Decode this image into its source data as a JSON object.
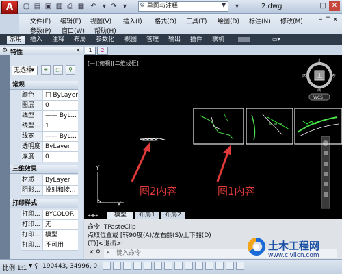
{
  "title_bar": {
    "app_logo": "A",
    "workspace": "草图与注释",
    "document_title": "2.dwg"
  },
  "menu": {
    "row1": [
      "文件(F)",
      "编辑(E)",
      "视图(V)",
      "插入(I)",
      "格式(O)",
      "工具(T)",
      "绘图(D)",
      "标注(N)",
      "修改(M)"
    ],
    "row2": [
      "参数(P)",
      "窗口(W)",
      "帮助(H)"
    ]
  },
  "ribbon_tabs": [
    "常用",
    "插入",
    "注释",
    "布局",
    "参数化",
    "视图",
    "管理",
    "输出",
    "插件",
    "联机"
  ],
  "properties_panel": {
    "title": "特性",
    "selection": "无选择",
    "sections": [
      {
        "name": "常规",
        "rows": [
          {
            "label": "颜色",
            "value": "□ ByLayer"
          },
          {
            "label": "图层",
            "value": "0"
          },
          {
            "label": "线型",
            "value": "—— ByL..."
          },
          {
            "label": "线型...",
            "value": "1"
          },
          {
            "label": "线宽",
            "value": "—— ByL..."
          },
          {
            "label": "透明度",
            "value": "ByLayer"
          },
          {
            "label": "厚度",
            "value": "0"
          }
        ]
      },
      {
        "name": "三维效果",
        "rows": [
          {
            "label": "材质",
            "value": "ByLayer"
          },
          {
            "label": "阴影...",
            "value": "投射和接..."
          }
        ]
      },
      {
        "name": "打印样式",
        "rows": [
          {
            "label": "打印...",
            "value": "BYCOLOR"
          },
          {
            "label": "打印...",
            "value": "无"
          },
          {
            "label": "打印...",
            "value": "模型"
          },
          {
            "label": "打印...",
            "value": "不可用"
          }
        ]
      }
    ]
  },
  "drawing_tabs": [
    "1",
    "2"
  ],
  "viewport_label": "[—][俯视][二维线框]",
  "viewcube": {
    "top": "上",
    "east": "东",
    "west": "西",
    "south": "南",
    "wcs": "WCS"
  },
  "annotations": {
    "fig2": "图2内容",
    "fig1": "图1内容",
    "fig_color": "#e03a3a"
  },
  "layout_tabs": [
    "模型",
    "布局1",
    "布局2"
  ],
  "command_area": {
    "line1": "命令: TPasteClip",
    "line2": "点取位置或 [转90度(A)/左右翻(S)/上下翻(D)",
    "line3": "(T)]<退出>:",
    "input_placeholder": "键入命令"
  },
  "status_bar": {
    "scale": "比例 1:1",
    "coordinates": "190443, 34996, 0"
  },
  "watermark": {
    "title": "土木工程网",
    "url": "www.civilcn.com"
  }
}
